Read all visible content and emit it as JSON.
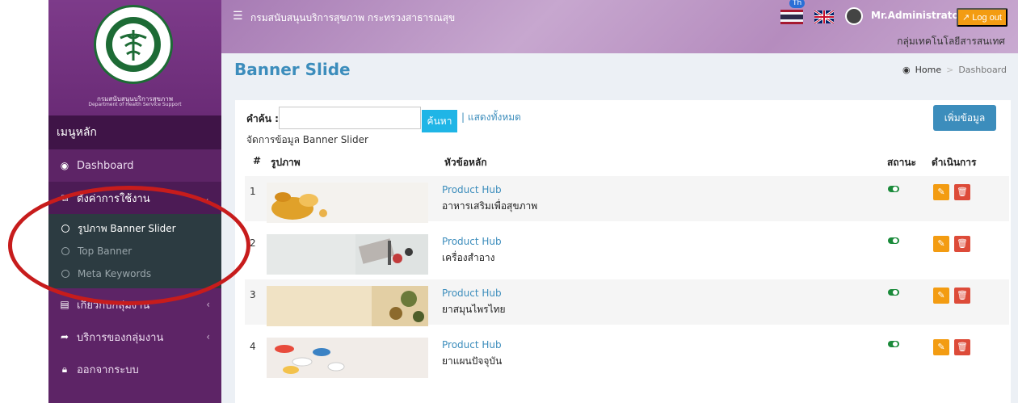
{
  "sidebar": {
    "brand_line1": "กรมสนับสนุนบริการสุขภาพ",
    "brand_line2": "Department of Health Service Support",
    "menu_header": "เมนูหลัก",
    "items": [
      {
        "label": "Dashboard",
        "icon": "dashboard-icon"
      },
      {
        "label": "ตั้งค่าการใช้งาน",
        "icon": "copy-icon"
      },
      {
        "label": "เกี่ยวกับกลุ่มงาน",
        "icon": "book-icon"
      },
      {
        "label": "บริการของกลุ่มงาน",
        "icon": "share-icon"
      },
      {
        "label": "ออกจากระบบ",
        "icon": "lock-icon"
      }
    ],
    "submenu": [
      {
        "label": "รูปภาพ Banner Slider"
      },
      {
        "label": "Top Banner"
      },
      {
        "label": "Meta Keywords"
      }
    ]
  },
  "topbar": {
    "title": "กรมสนับสนุนบริการสุขภาพ กระทรวงสาธารณสุข",
    "lang_badge": "Th",
    "user_name": "Mr.Administrator",
    "logout_label": "Log out",
    "org_sub": "กลุ่มเทคโนโลยีสารสนเทศ"
  },
  "page": {
    "title": "Banner Slide",
    "breadcrumb": {
      "home": "Home",
      "current": "Dashboard"
    }
  },
  "toolbar": {
    "search_label": "คำค้น :",
    "search_value": "",
    "search_button": "ค้นหา",
    "show_all": "| แสดงทั้งหมด",
    "manage_text": "จัดการข้อมูล Banner Slider",
    "add_button": "เพิ่มข้อมูล"
  },
  "table": {
    "headers": {
      "num": "#",
      "image": "รูปภาพ",
      "topic": "หัวข้อหลัก",
      "status": "สถานะ",
      "actions": "ดำเนินการ"
    },
    "rows": [
      {
        "num": "1",
        "title": "Product Hub",
        "subtitle": "อาหารเสริมเพื่อสุขภาพ",
        "status": "on"
      },
      {
        "num": "2",
        "title": "Product Hub",
        "subtitle": "เครื่องสำอาง",
        "status": "on"
      },
      {
        "num": "3",
        "title": "Product Hub",
        "subtitle": "ยาสมุนไพรไทย",
        "status": "on"
      },
      {
        "num": "4",
        "title": "Product Hub",
        "subtitle": "ยาแผนปัจจุบัน",
        "status": "on"
      }
    ]
  },
  "colors": {
    "sidebar": "#5d2466",
    "accent": "#3c8dbc",
    "edit": "#f39c12",
    "delete": "#dd4b39",
    "annotation": "#c71c1c"
  }
}
